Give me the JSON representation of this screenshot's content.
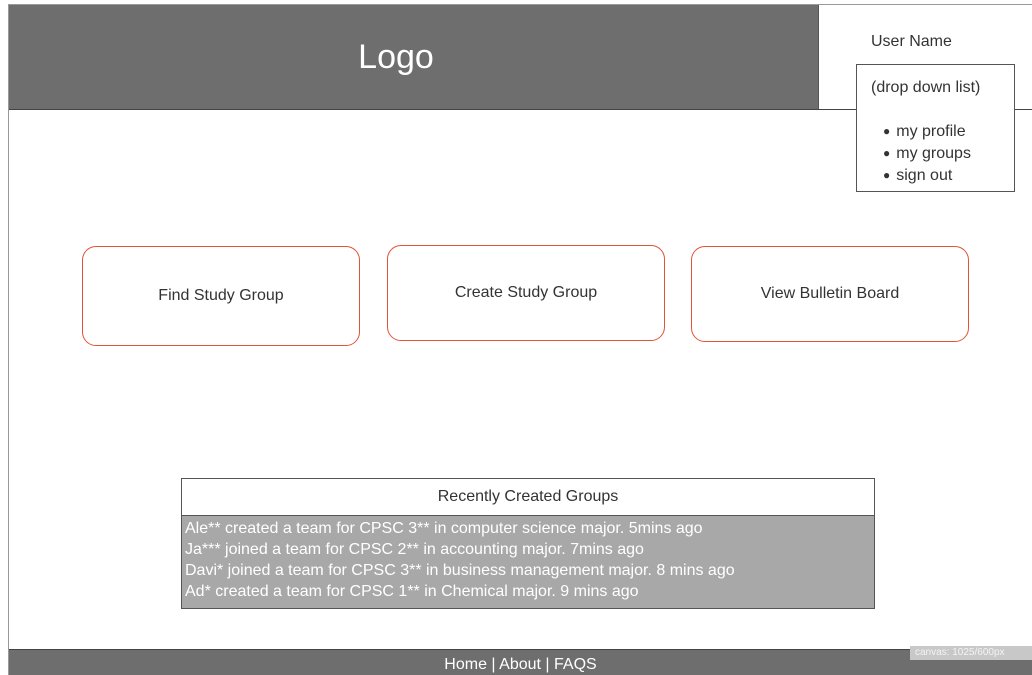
{
  "header": {
    "logo_text": "Logo",
    "user_name": "User Name"
  },
  "dropdown": {
    "title": "(drop down list)",
    "items": [
      {
        "label": "my profile"
      },
      {
        "label": "my groups"
      },
      {
        "label": "sign out"
      }
    ]
  },
  "actions": {
    "find": "Find Study Group",
    "create": "Create Study Group",
    "bulletin": "View Bulletin Board"
  },
  "recent": {
    "title": "Recently Created Groups",
    "items": [
      "Ale** created a team for CPSC 3** in computer science major. 5mins ago",
      "Ja*** joined a team for CPSC 2** in accounting major. 7mins ago",
      "Davi* joined a team for CPSC 3** in business management major. 8 mins ago",
      "Ad* created a team for CPSC 1** in Chemical major. 9 mins ago"
    ]
  },
  "footer": {
    "home": "Home",
    "about": "About",
    "faqs": "FAQS",
    "separator": "|"
  },
  "canvas_label": "canvas: 1025/600px",
  "colors": {
    "header_bg": "#6e6e6e",
    "button_border": "#e0553a",
    "panel_bg": "#a8a8a8"
  }
}
